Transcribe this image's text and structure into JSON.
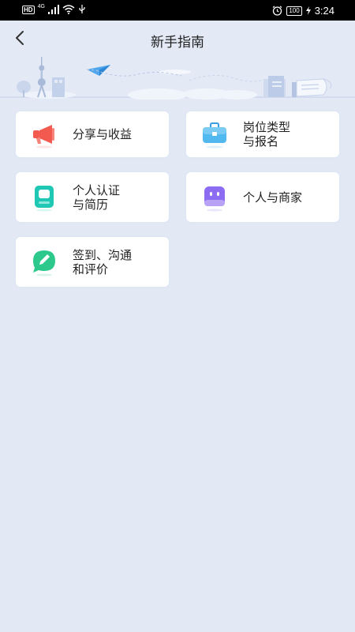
{
  "status_bar": {
    "hd": "HD",
    "network": "4G",
    "battery": "100",
    "time": "3:24"
  },
  "header": {
    "title": "新手指南",
    "back_icon": "chevron-left-icon"
  },
  "colors": {
    "background": "#e2e9f5",
    "card": "#ffffff",
    "share_icon": "#f25a50",
    "job_icon": "#52b9f0",
    "certify_icon": "#1fc8b4",
    "merchant_icon": "#8c6cf0",
    "sign_icon": "#2dc98c"
  },
  "cards": [
    {
      "label": "分享与收益",
      "icon": "megaphone-icon"
    },
    {
      "label": "岗位类型\n与报名",
      "icon": "briefcase-icon"
    },
    {
      "label": "个人认证\n与简历",
      "icon": "resume-icon"
    },
    {
      "label": "个人与商家",
      "icon": "robot-icon"
    },
    {
      "label": "签到、沟通\n和评价",
      "icon": "chat-edit-icon"
    }
  ]
}
